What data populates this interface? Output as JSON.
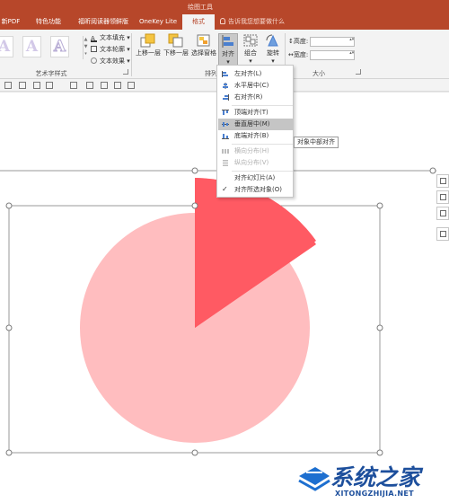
{
  "tabs": {
    "context_label": "绘图工具",
    "items": [
      {
        "label": "新PDF"
      },
      {
        "label": "特色功能"
      },
      {
        "label": "福昕阅读器领鲜版"
      },
      {
        "label": "OneKey Lite"
      },
      {
        "label": "格式"
      }
    ],
    "tell_me": "告诉我您想要做什么"
  },
  "ribbon": {
    "wordart_group": {
      "label": "艺术字样式",
      "styles": [
        "A",
        "A",
        "A"
      ],
      "text_fill": "文本填充",
      "text_outline": "文本轮廓",
      "text_effects": "文本效果"
    },
    "arrange_group": {
      "label": "排列",
      "bring_forward": "上移一层",
      "send_backward": "下移一层",
      "selection_pane": "选择窗格",
      "align": "对齐",
      "group": "组合",
      "rotate": "旋转"
    },
    "size_group": {
      "label": "大小",
      "height_label": "高度:",
      "width_label": "宽度:"
    }
  },
  "align_menu": {
    "items": [
      {
        "label": "左对齐(L)",
        "enabled": true,
        "highlighted": false,
        "icon": "align-left-icon"
      },
      {
        "label": "水平居中(C)",
        "enabled": true,
        "highlighted": false,
        "icon": "align-center-icon"
      },
      {
        "label": "右对齐(R)",
        "enabled": true,
        "highlighted": false,
        "icon": "align-right-icon"
      },
      {
        "label": "顶端对齐(T)",
        "enabled": true,
        "highlighted": false,
        "icon": "align-top-icon"
      },
      {
        "label": "垂直居中(M)",
        "enabled": true,
        "highlighted": true,
        "icon": "align-middle-icon"
      },
      {
        "label": "底端对齐(B)",
        "enabled": true,
        "highlighted": false,
        "icon": "align-bottom-icon"
      },
      {
        "label": "横向分布(H)",
        "enabled": false,
        "highlighted": false,
        "icon": "distribute-horizontal-icon"
      },
      {
        "label": "纵向分布(V)",
        "enabled": false,
        "highlighted": false,
        "icon": "distribute-vertical-icon"
      },
      {
        "label": "对齐幻灯片(A)",
        "enabled": true,
        "highlighted": false,
        "icon": ""
      },
      {
        "label": "对齐所选对象(O)",
        "enabled": true,
        "highlighted": false,
        "icon": "checkmark-icon"
      }
    ],
    "tooltip": "对象中部对齐"
  },
  "watermark": {
    "title": "系统之家",
    "url": "XITONGZHIJIA.NET"
  },
  "colors": {
    "title_bar": "#b7472a",
    "pie_main": "#ffbdbf",
    "pie_slice": "#ff5a63",
    "menu_highlight": "#c5c5c5",
    "watermark_blue": "#1d4f9c"
  }
}
